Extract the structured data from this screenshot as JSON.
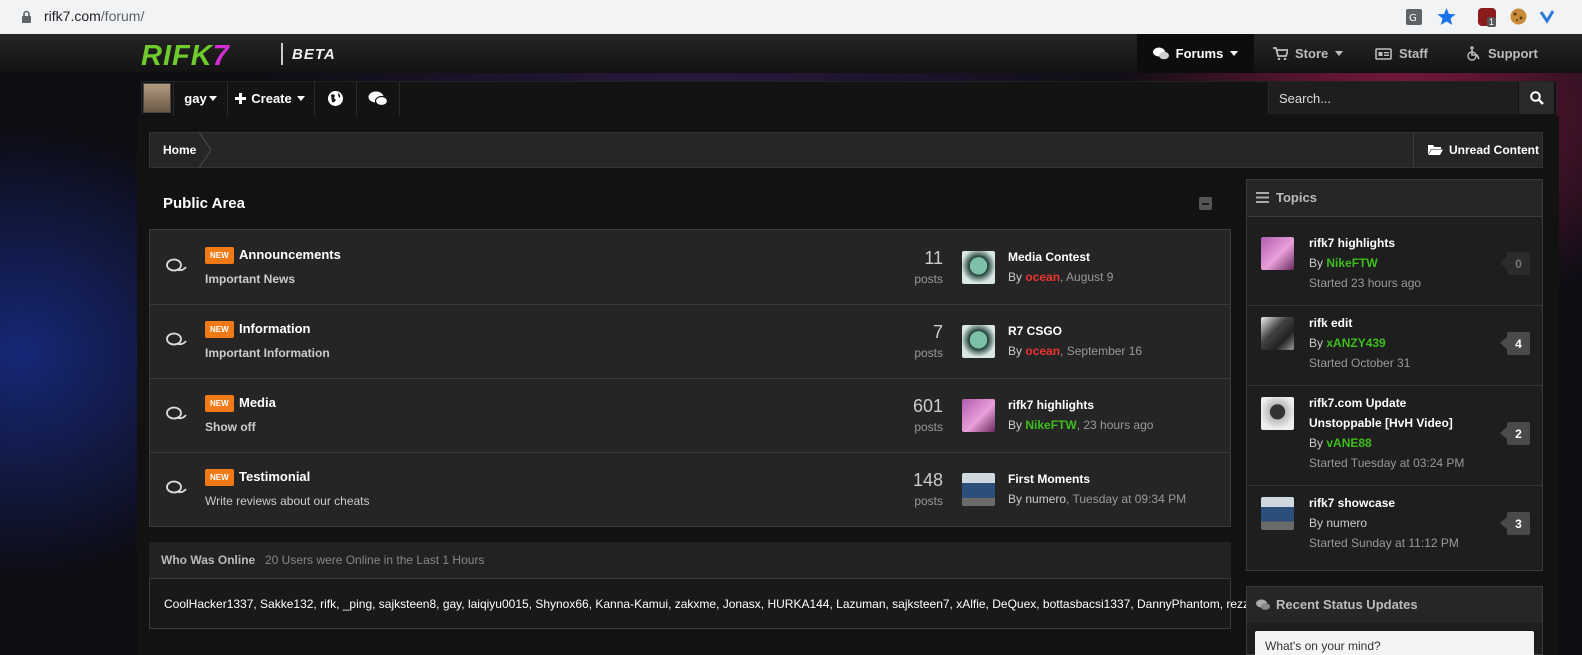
{
  "browser": {
    "url_host": "rifk7.com",
    "url_path": "/forum/",
    "ext_badge": "1"
  },
  "header": {
    "logo_left": "RIFK",
    "logo_right": "7",
    "beta": "BETA",
    "nav": [
      {
        "label": "Forums",
        "icon": "chat-bubbles-icon",
        "active": true
      },
      {
        "label": "Store",
        "icon": "cart-icon"
      },
      {
        "label": "Staff",
        "icon": "id-card-icon"
      },
      {
        "label": "Support",
        "icon": "wheelchair-icon"
      }
    ]
  },
  "userbar": {
    "username": "gay",
    "create_label": "Create",
    "search_placeholder": "Search..."
  },
  "breadcrumb": {
    "home": "Home",
    "unread": "Unread Content"
  },
  "public_area": {
    "title": "Public Area",
    "forums": [
      {
        "badge": "NEW",
        "title": "Announcements",
        "desc": "Important News",
        "count": "11",
        "posts_label": "posts",
        "last_title": "Media Contest",
        "last_by": "By",
        "last_user": "ocean",
        "last_user_color": "#e33333",
        "last_date": ", August 9"
      },
      {
        "badge": "NEW",
        "title": "Information",
        "desc": "Important Information",
        "count": "7",
        "posts_label": "posts",
        "last_title": "R7 CSGO",
        "last_by": "By",
        "last_user": "ocean",
        "last_user_color": "#e33333",
        "last_date": ", September 16"
      },
      {
        "badge": "NEW",
        "title": "Media",
        "desc": "Show off",
        "count": "601",
        "posts_label": "posts",
        "last_title": "rifk7 highlights",
        "last_by": "By",
        "last_user": "NikeFTW",
        "last_user_color": "#3ebd1f",
        "last_date": ", 23 hours ago"
      },
      {
        "badge": "NEW",
        "title": "Testimonial",
        "desc": "Write reviews about our cheats",
        "count": "148",
        "posts_label": "posts",
        "last_title": "First Moments",
        "last_by": "By",
        "last_user": "numero",
        "last_user_color": "#cccccc",
        "last_date": ", Tuesday at 09:34 PM"
      }
    ]
  },
  "who_online": {
    "title": "Who Was Online",
    "subtitle": "20 Users were Online in the Last 1 Hours",
    "names": "CoolHacker1337, Sakke132, rifk, _ping, sajksteen8, gay, laiqiyu0015, Shynox66, Kanna-Kamui, zakxme, Jonasx, HURKA144, Lazuman, sajksteen7, xAlfie, DeQuex, bottasbacsi1337, DannyPhantom, rezz"
  },
  "topics": {
    "title": "Topics",
    "items": [
      {
        "title": "rifk7 highlights",
        "by": "By",
        "user": "NikeFTW",
        "user_color": "#3ebd1f",
        "started": "Started 23 hours ago",
        "count": "0"
      },
      {
        "title": "rifk edit",
        "by": "By",
        "user": "xANZY439",
        "user_color": "#3ebd1f",
        "started": "Started October 31",
        "count": "4"
      },
      {
        "title": "rifk7.com Update Unstoppable [HvH Video]",
        "by": "By",
        "user": "vANE88",
        "user_color": "#3ebd1f",
        "started": "Started Tuesday at 03:24 PM",
        "count": "2"
      },
      {
        "title": "rifk7 showcase",
        "by": "By",
        "user": "numero",
        "user_color": "#cccccc",
        "started": "Started Sunday at 11:12 PM",
        "count": "3"
      }
    ]
  },
  "status_updates": {
    "title": "Recent Status Updates",
    "placeholder": "What's on your mind?"
  }
}
